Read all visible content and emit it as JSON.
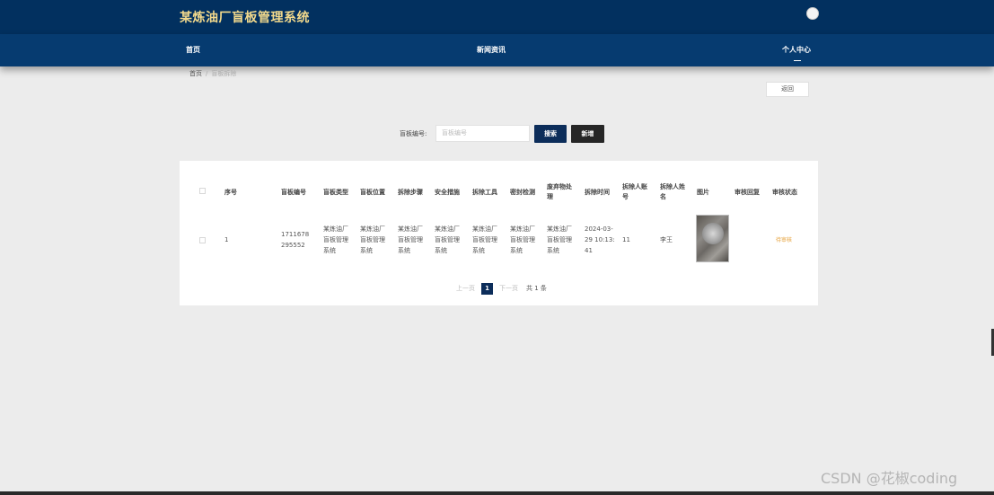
{
  "header": {
    "app_title": "某炼油厂盲板管理系统"
  },
  "nav": {
    "home": "首页",
    "news": "新闻资讯",
    "personal": "个人中心"
  },
  "breadcrumb": {
    "home": "首页",
    "separator": "/",
    "current": "盲板拆除"
  },
  "back_label": "返回",
  "search": {
    "label": "盲板编号:",
    "placeholder": "盲板编号",
    "search_label": "搜索",
    "add_label": "新增"
  },
  "table": {
    "headers": [
      "序号",
      "盲板编号",
      "盲板类型",
      "盲板位置",
      "拆除步骤",
      "安全措施",
      "拆除工具",
      "密封检测",
      "废弃物处理",
      "拆除时间",
      "拆除人账号",
      "拆除人姓名",
      "图片",
      "审核回复",
      "审核状态"
    ],
    "rows": [
      {
        "index": "1",
        "code": "1711678295552",
        "type": "某炼油厂盲板管理系统",
        "position": "某炼油厂盲板管理系统",
        "steps": "某炼油厂盲板管理系统",
        "safety": "某炼油厂盲板管理系统",
        "tools": "某炼油厂盲板管理系统",
        "seal_check": "某炼油厂盲板管理系统",
        "waste": "某炼油厂盲板管理系统",
        "time": "2024-03-29 10:13:41",
        "account": "11",
        "name": "李王",
        "reply": "",
        "status": "待审核"
      }
    ]
  },
  "pagination": {
    "prev": "上一页",
    "page": "1",
    "next": "下一页",
    "total": "共 1 条"
  },
  "watermark": "CSDN @花椒coding",
  "colors": {
    "header_bg": "#02305f",
    "nav_bg": "#063b70",
    "title_gold": "#f2d98c",
    "primary_button": "#0c2d5a",
    "add_button": "#262626",
    "status_pending": "#e6a23c"
  }
}
